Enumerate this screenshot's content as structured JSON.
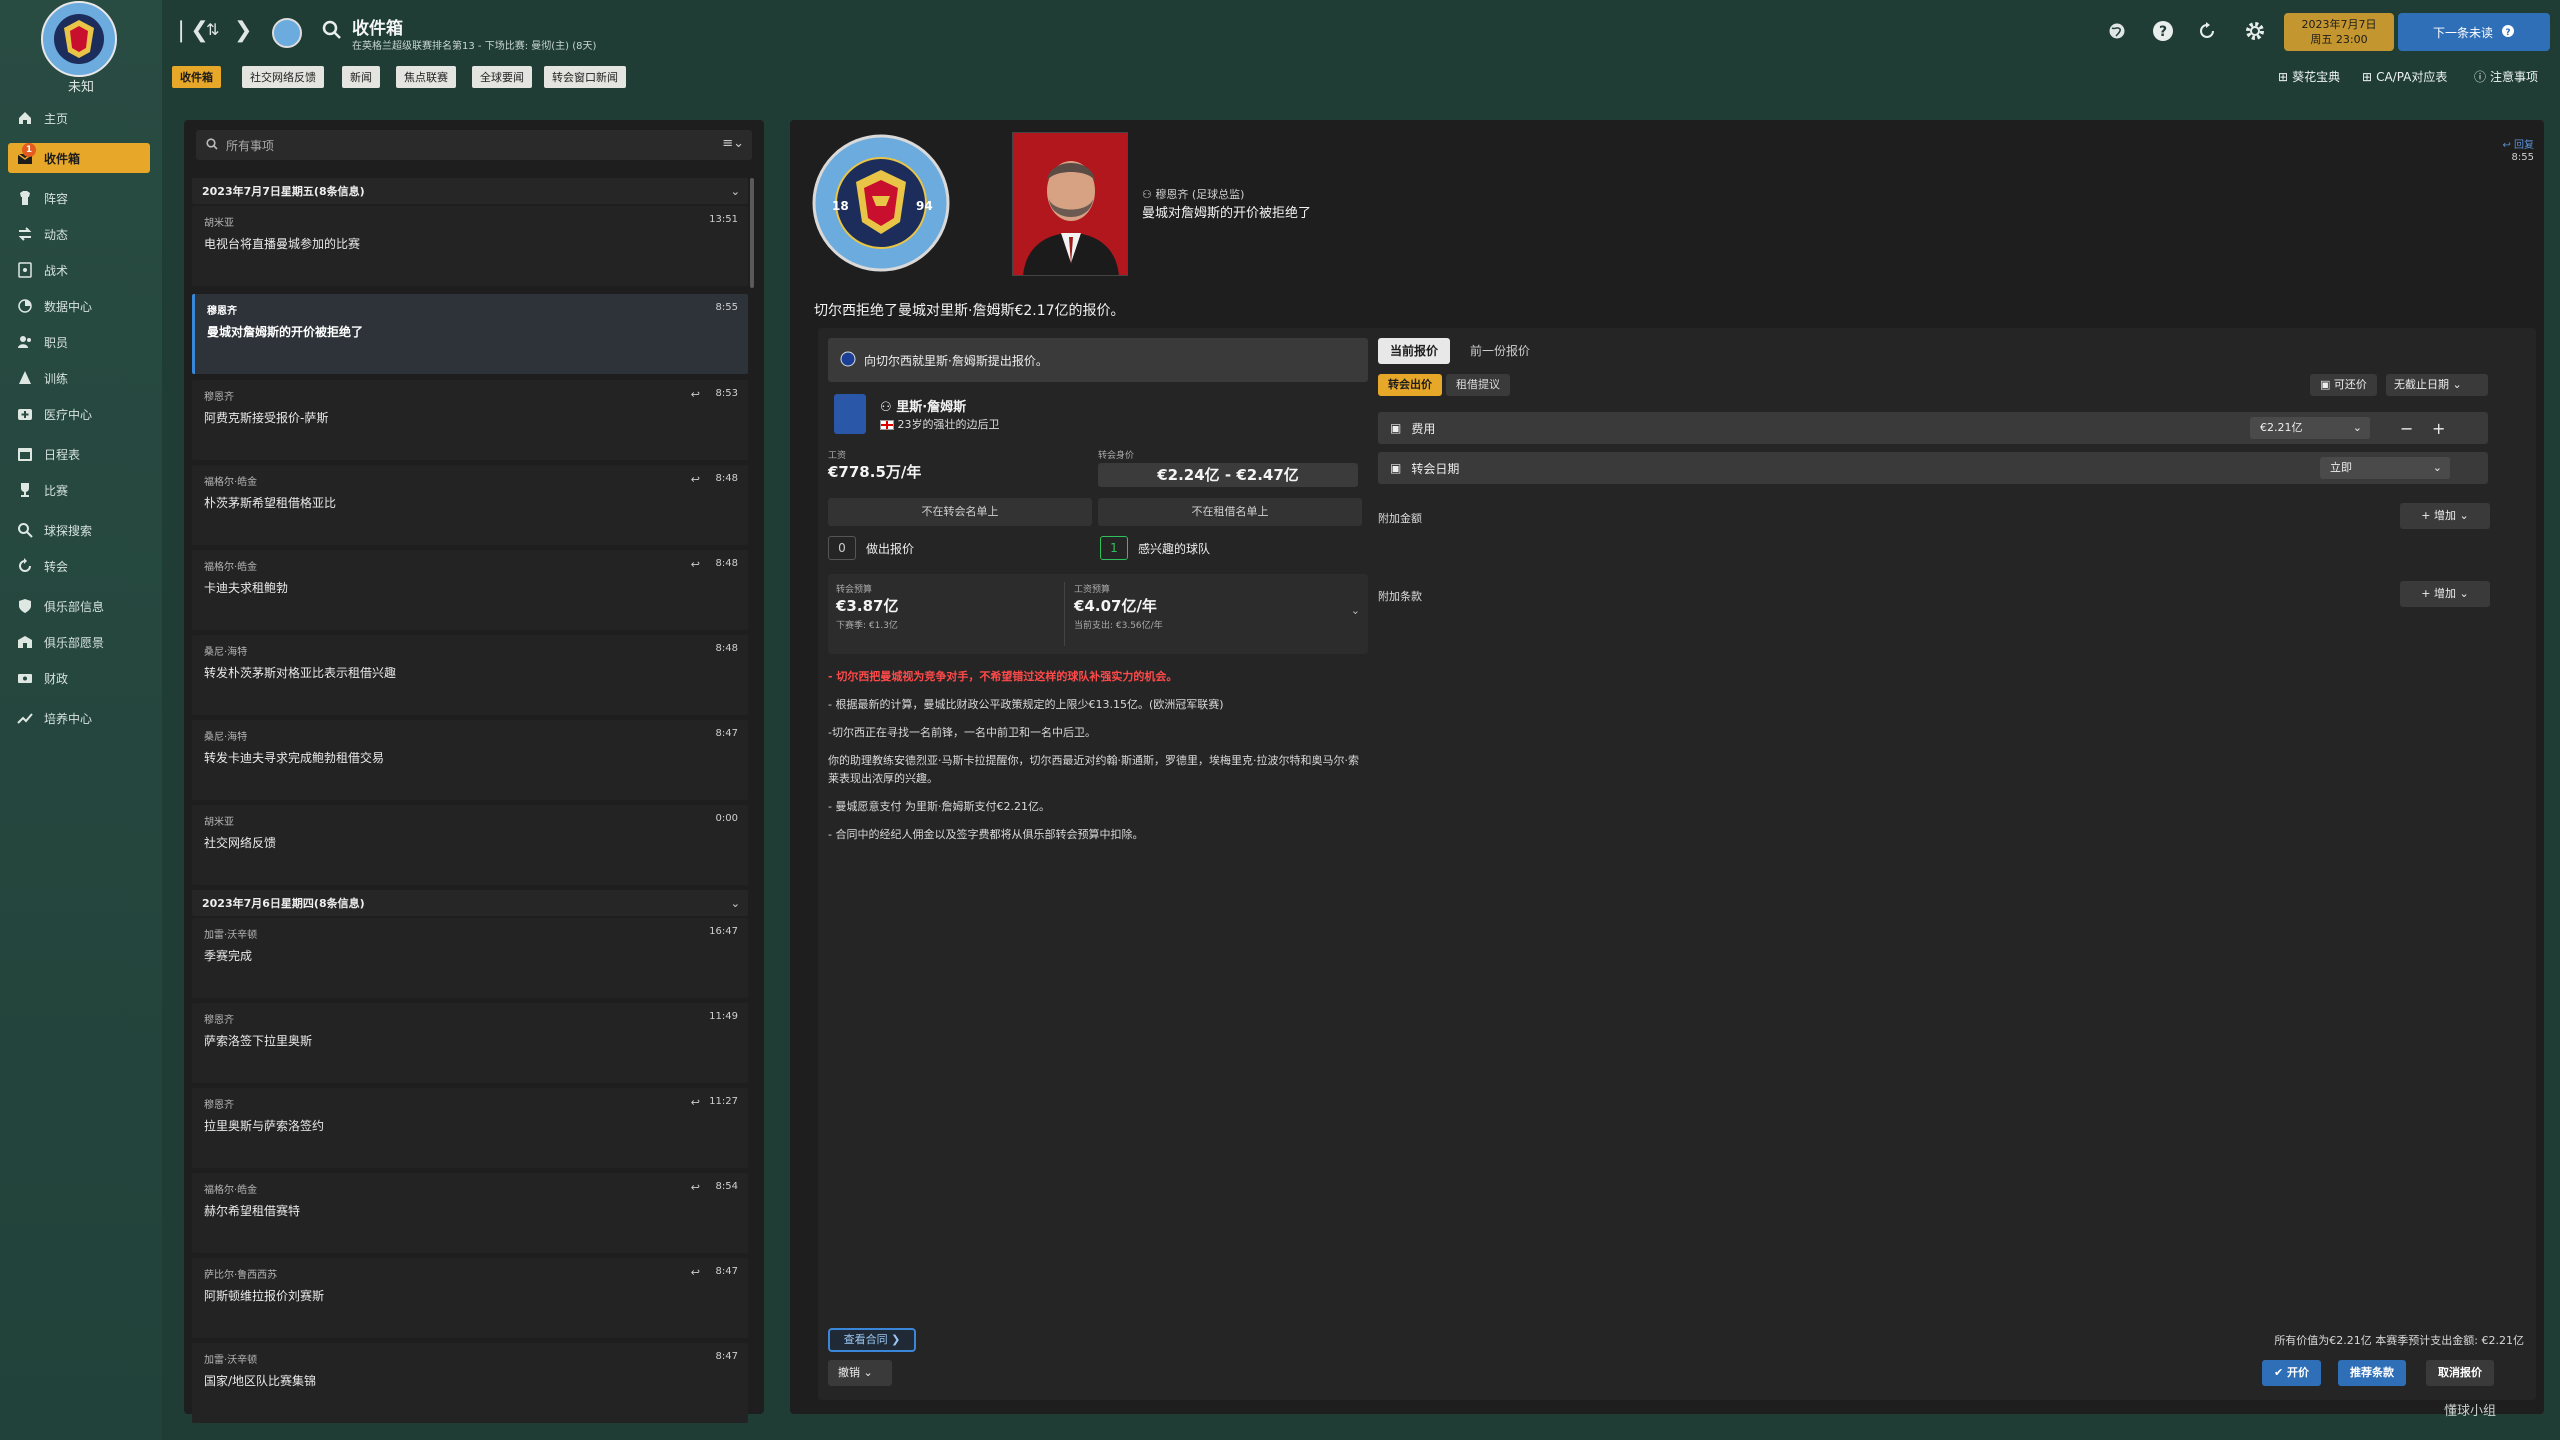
{
  "club": {
    "badge_text": "MANCHESTER CITY",
    "badge_year_left": "18",
    "badge_year_right": "94",
    "status_label": "未知"
  },
  "sidebar": {
    "items": [
      {
        "label": "主页",
        "icon": "home-icon"
      },
      {
        "label": "收件箱",
        "icon": "inbox-icon",
        "badge": "1"
      },
      {
        "label": "阵容",
        "icon": "squad-icon"
      },
      {
        "label": "动态",
        "icon": "dynamics-icon"
      },
      {
        "label": "战术",
        "icon": "tactics-icon"
      },
      {
        "label": "数据中心",
        "icon": "data-hub-icon"
      },
      {
        "label": "职员",
        "icon": "staff-icon"
      },
      {
        "label": "训练",
        "icon": "training-icon"
      },
      {
        "label": "医疗中心",
        "icon": "medical-icon"
      },
      {
        "label": "日程表",
        "icon": "schedule-icon"
      },
      {
        "label": "比赛",
        "icon": "trophy-icon"
      },
      {
        "label": "球探搜索",
        "icon": "scouting-icon"
      },
      {
        "label": "转会",
        "icon": "transfers-icon"
      },
      {
        "label": "俱乐部信息",
        "icon": "club-info-icon"
      },
      {
        "label": "俱乐部愿景",
        "icon": "club-vision-icon"
      },
      {
        "label": "财政",
        "icon": "finances-icon"
      },
      {
        "label": "培养中心",
        "icon": "development-icon"
      }
    ]
  },
  "topbar": {
    "title": "收件箱",
    "subtitle": "在英格兰超级联赛排名第13 - 下场比赛: 曼彻(主) (8天)",
    "date_line1": "2023年7月7日",
    "date_line2": "周五 23:00",
    "continue_label": "下一条未读",
    "right_links": [
      "葵花宝典",
      "CA/PA对应表",
      "注意事项"
    ]
  },
  "filter_tabs": [
    "收件箱",
    "社交网络反馈",
    "新闻",
    "焦点联赛",
    "全球要闻",
    "转会窗口新闻"
  ],
  "search": {
    "placeholder": "所有事项"
  },
  "messages": {
    "day1": "2023年7月7日星期五(8条信息)",
    "day2": "2023年7月6日星期四(8条信息)",
    "items": [
      {
        "from": "胡米亚",
        "subject": "电视台将直播曼城参加的比赛",
        "time": "13:51",
        "reply": false
      },
      {
        "from": "穆恩齐",
        "subject": "曼城对詹姆斯的开价被拒绝了",
        "time": "8:55",
        "reply": false
      },
      {
        "from": "穆恩齐",
        "subject": "阿费克斯接受报价-萨斯",
        "time": "8:53",
        "reply": true
      },
      {
        "from": "福格尔·皓金",
        "subject": "朴茨茅斯希望租借格亚比",
        "time": "8:48",
        "reply": true
      },
      {
        "from": "福格尔·皓金",
        "subject": "卡迪夫求租鲍勃",
        "time": "8:48",
        "reply": true
      },
      {
        "from": "桑尼·海特",
        "subject": "转发朴茨茅斯对格亚比表示租借兴趣",
        "time": "8:48",
        "reply": false
      },
      {
        "from": "桑尼·海特",
        "subject": "转发卡迪夫寻求完成鲍勃租借交易",
        "time": "8:47",
        "reply": false
      },
      {
        "from": "胡米亚",
        "subject": "社交网络反馈",
        "time": "0:00",
        "reply": false
      },
      {
        "from": "加雷·沃辛顿",
        "subject": "季赛完成",
        "time": "16:47",
        "reply": false
      },
      {
        "from": "穆恩齐",
        "subject": "萨索洛签下拉里奥斯",
        "time": "11:49",
        "reply": false
      },
      {
        "from": "穆恩齐",
        "subject": "拉里奥斯与萨索洛签约",
        "time": "11:27",
        "reply": true
      },
      {
        "from": "福格尔·皓金",
        "subject": "赫尔希望租借赛特",
        "time": "8:54",
        "reply": true
      },
      {
        "from": "萨比尔·鲁西西苏",
        "subject": "阿斯顿维拉报价刘赛斯",
        "time": "8:47",
        "reply": true
      },
      {
        "from": "加雷·沃辛顿",
        "subject": "国家/地区队比赛集锦",
        "time": "8:47",
        "reply": false
      }
    ]
  },
  "detail": {
    "sender": "穆恩齐 (足球总监)",
    "headline_top": "曼城对詹姆斯的开价被拒绝了",
    "headline_main": "切尔西拒绝了曼城对里斯·詹姆斯€2.17亿的报价。",
    "reply_link": "回复",
    "time": "8:55",
    "offer_title": "向切尔西就里斯·詹姆斯提出报价。",
    "player_name": "里斯·詹姆斯",
    "player_desc": "23岁的强壮的边后卫",
    "wage_label": "工资",
    "wage_value": "€778.5万/年",
    "value_label": "转会身价",
    "value_value": "€2.24亿 - €2.47亿",
    "not_transfer_listed": "不在转会名单上",
    "not_loan_listed": "不在租借名单上",
    "offers_count": "0",
    "offers_label": "做出报价",
    "interested_count": "1",
    "interested_label": "感兴趣的球队",
    "transfer_budget_label": "转会预算",
    "transfer_budget": "€3.87亿",
    "transfer_budget_next": "下赛季: €1.3亿",
    "wage_budget_label": "工资预算",
    "wage_budget": "€4.07亿/年",
    "wage_budget_current": "当前支出: €3.56亿/年",
    "bullets": [
      "- 切尔西把曼城视为竞争对手，不希望错过这样的球队补强实力的机会。",
      "- 根据最新的计算，曼城比财政公平政策规定的上限少€13.15亿。(欧洲冠军联赛)",
      "-切尔西正在寻找一名前锋，一名中前卫和一名中后卫。",
      "你的助理教练安德烈亚·马斯卡拉提醒你，切尔西最近对约翰·斯通斯，罗德里，埃梅里克·拉波尔特和奥马尔·索莱表现出浓厚的兴趣。",
      "- 曼城愿意支付 为里斯·詹姆斯支付€2.21亿。",
      "- 合同中的经纪人佣金以及签字费都将从俱乐部转会预算中扣除。"
    ],
    "tab_current": "当前报价",
    "tab_previous": "前一份报价",
    "subtab_transfer": "转会出价",
    "subtab_loan": "租借提议",
    "negotiable": "可还价",
    "expiry": "无截止日期",
    "fee_label": "费用",
    "fee_value": "€2.21亿",
    "date_label": "转会日期",
    "date_value": "立即",
    "add_fee_label": "附加金额",
    "add_clause_label": "附加条款",
    "add_button": "增加",
    "view_contract": "查看合同",
    "withdraw": "撤销",
    "summary": "所有价值为€2.21亿    本赛季预计支出金额: €2.21亿",
    "btn_offer": "开价",
    "btn_terms": "推荐条款",
    "btn_cancel": "取消报价"
  },
  "watermark": "懂球小组",
  "colors": {
    "accent": "#e7a729",
    "primary_blue": "#2f6fb7",
    "alert_red": "#ff4a4a",
    "success_green": "#31c15b"
  }
}
